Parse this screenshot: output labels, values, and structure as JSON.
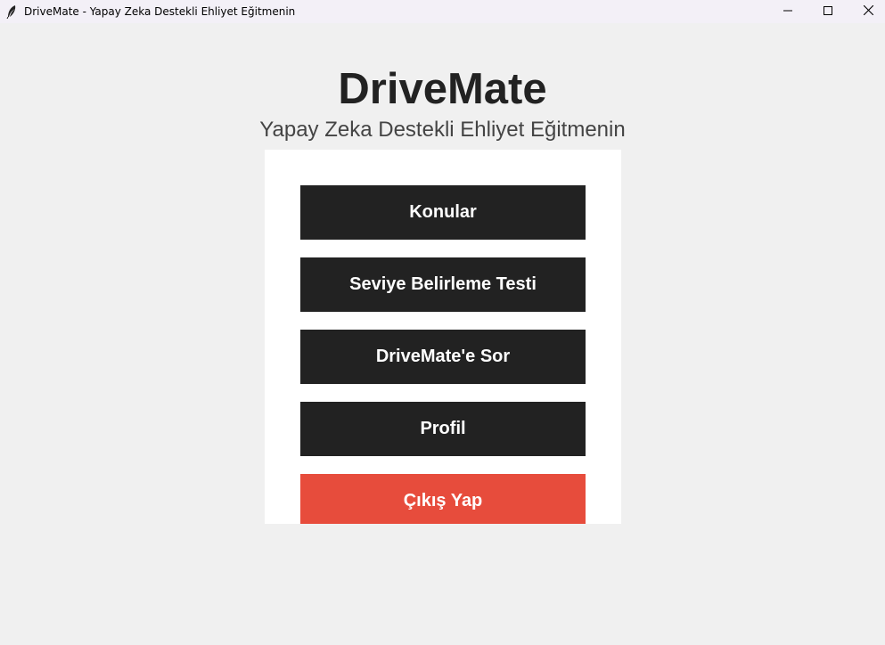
{
  "window": {
    "title": "DriveMate - Yapay Zeka Destekli Ehliyet Eğitmenin",
    "icon": "feather-icon",
    "controls": [
      "minimize-icon",
      "maximize-icon",
      "close-icon"
    ]
  },
  "header": {
    "title": "DriveMate",
    "subtitle": "Yapay Zeka Destekli Ehliyet Eğitmenin"
  },
  "menu": {
    "items": [
      {
        "label": "Konular"
      },
      {
        "label": "Seviye Belirleme Testi"
      },
      {
        "label": "DriveMate'e Sor"
      },
      {
        "label": "Profil"
      },
      {
        "label": "Çıkış Yap"
      }
    ]
  },
  "colors": {
    "background": "#f0f0f0",
    "panel": "#ffffff",
    "button": "#222222",
    "logout_button": "#e74c3c",
    "button_text": "#ffffff"
  }
}
